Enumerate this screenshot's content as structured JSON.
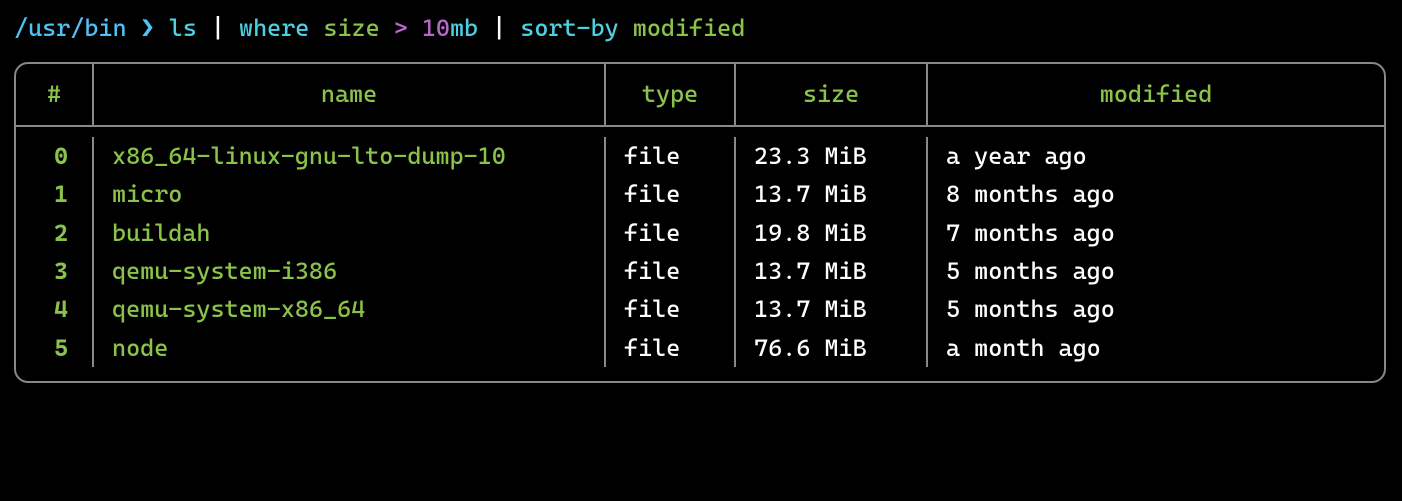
{
  "prompt": {
    "path": "/usr/bin",
    "separator": "❯",
    "tokens": [
      {
        "text": "ls",
        "class": "cmd"
      },
      {
        "text": " | ",
        "class": "pipe"
      },
      {
        "text": "where",
        "class": "cmd"
      },
      {
        "text": " ",
        "class": ""
      },
      {
        "text": "size",
        "class": "arg-green"
      },
      {
        "text": " ",
        "class": ""
      },
      {
        "text": ">",
        "class": "op"
      },
      {
        "text": " ",
        "class": ""
      },
      {
        "text": "10",
        "class": "num"
      },
      {
        "text": "mb",
        "class": "unit"
      },
      {
        "text": " | ",
        "class": "pipe"
      },
      {
        "text": "sort-by",
        "class": "cmd"
      },
      {
        "text": " ",
        "class": ""
      },
      {
        "text": "modified",
        "class": "arg-green"
      }
    ]
  },
  "table": {
    "headers": {
      "idx": "#",
      "name": "name",
      "type": "type",
      "size": "size",
      "modified": "modified"
    },
    "rows": [
      {
        "idx": "0",
        "name": "x86_64-linux-gnu-lto-dump-10",
        "type": "file",
        "size": "23.3 MiB",
        "modified": "a year ago"
      },
      {
        "idx": "1",
        "name": "micro",
        "type": "file",
        "size": "13.7 MiB",
        "modified": "8 months ago"
      },
      {
        "idx": "2",
        "name": "buildah",
        "type": "file",
        "size": "19.8 MiB",
        "modified": "7 months ago"
      },
      {
        "idx": "3",
        "name": "qemu-system-i386",
        "type": "file",
        "size": "13.7 MiB",
        "modified": "5 months ago"
      },
      {
        "idx": "4",
        "name": "qemu-system-x86_64",
        "type": "file",
        "size": "13.7 MiB",
        "modified": "5 months ago"
      },
      {
        "idx": "5",
        "name": "node",
        "type": "file",
        "size": "76.6 MiB",
        "modified": "a month ago"
      }
    ]
  }
}
